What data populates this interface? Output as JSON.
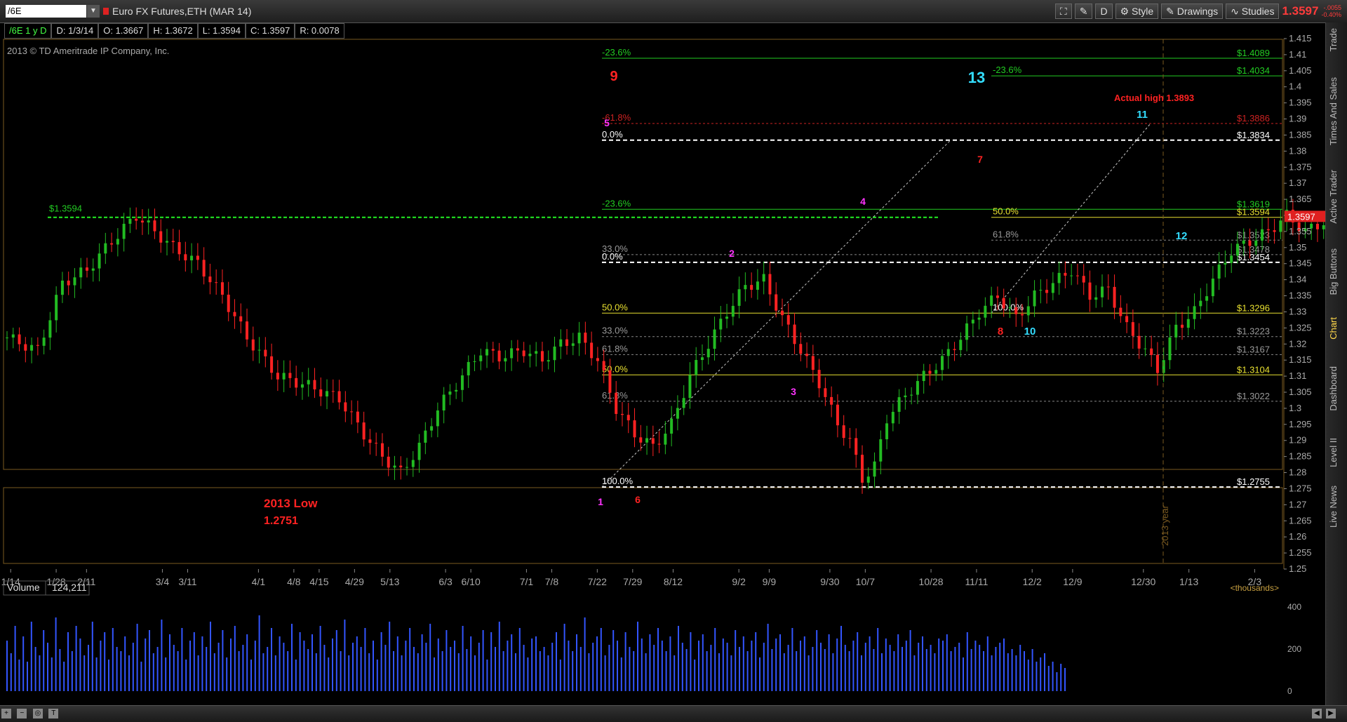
{
  "header": {
    "symbol": "/6E",
    "description": "Euro FX Futures,ETH (MAR 14)",
    "buttons": [
      "Style",
      "Drawings",
      "Studies"
    ],
    "last_price": "1.3597",
    "net_change": "-.0055",
    "pct_change": "-0.40%"
  },
  "infobar": {
    "period": "/6E 1 y D",
    "date": "D: 1/3/14",
    "open": "O: 1.3667",
    "high": "H: 1.3672",
    "low": "L: 1.3594",
    "close": "C: 1.3597",
    "range": "R: 0.0078"
  },
  "copyright": "2013 © TD Ameritrade IP Company, Inc.",
  "right_tabs": [
    "Trade",
    "Times And Sales",
    "Active Trader",
    "Big Buttons",
    "Chart",
    "Dashboard",
    "Level II",
    "Live News"
  ],
  "volume_panel": {
    "label": "Volume",
    "value": "124,211",
    "units": "<thousands>",
    "ticks": [
      "400",
      "200",
      "0"
    ]
  },
  "colors": {
    "up": "#22bb22",
    "down": "#ff2222",
    "volume": "#3355ff",
    "fib_green": "#22cc22",
    "fib_yellow": "#e8e030",
    "fib_red": "#cc2222",
    "wave_magenta": "#ff33ff",
    "wave_cyan": "#33ddff",
    "wave_red": "#ff2222"
  },
  "chart_data": {
    "type": "candlestick",
    "y_range": [
      1.25,
      1.415
    ],
    "y_ticks": [
      "1.415",
      "1.41",
      "1.405",
      "1.4",
      "1.395",
      "1.39",
      "1.385",
      "1.38",
      "1.375",
      "1.37",
      "1.365",
      "1.36",
      "1.355",
      "1.35",
      "1.345",
      "1.34",
      "1.335",
      "1.33",
      "1.325",
      "1.32",
      "1.315",
      "1.31",
      "1.305",
      "1.3",
      "1.295",
      "1.29",
      "1.285",
      "1.28",
      "1.275",
      "1.27",
      "1.265",
      "1.26",
      "1.255",
      "1.25"
    ],
    "x_ticks": [
      "1/14",
      "1/28",
      "2/11",
      "3/4",
      "3/11",
      "4/1",
      "4/8",
      "4/15",
      "4/29",
      "5/13",
      "6/3",
      "6/10",
      "7/1",
      "7/8",
      "7/22",
      "7/29",
      "8/12",
      "9/2",
      "9/9",
      "9/30",
      "10/7",
      "10/28",
      "11/11",
      "12/2",
      "12/9",
      "12/30",
      "1/13",
      "2/3"
    ],
    "last_price_marker": "1.3597",
    "year_marker": "2013 year",
    "close_path": [
      [
        0,
        1.322
      ],
      [
        5,
        1.318
      ],
      [
        9,
        1.339
      ],
      [
        13,
        1.343
      ],
      [
        17,
        1.352
      ],
      [
        21,
        1.36
      ],
      [
        24,
        1.355
      ],
      [
        27,
        1.35
      ],
      [
        31,
        1.345
      ],
      [
        35,
        1.335
      ],
      [
        39,
        1.322
      ],
      [
        44,
        1.31
      ],
      [
        49,
        1.307
      ],
      [
        54,
        1.303
      ],
      [
        58,
        1.292
      ],
      [
        61,
        1.285
      ],
      [
        64,
        1.28
      ],
      [
        67,
        1.288
      ],
      [
        70,
        1.3
      ],
      [
        74,
        1.31
      ],
      [
        77,
        1.318
      ],
      [
        80,
        1.316
      ],
      [
        84,
        1.318
      ],
      [
        87,
        1.315
      ],
      [
        90,
        1.32
      ],
      [
        93,
        1.322
      ],
      [
        96,
        1.315
      ],
      [
        99,
        1.3
      ],
      [
        102,
        1.292
      ],
      [
        105,
        1.288
      ],
      [
        108,
        1.295
      ],
      [
        111,
        1.31
      ],
      [
        114,
        1.32
      ],
      [
        117,
        1.33
      ],
      [
        120,
        1.338
      ],
      [
        123,
        1.34
      ],
      [
        126,
        1.328
      ],
      [
        129,
        1.318
      ],
      [
        132,
        1.308
      ],
      [
        135,
        1.295
      ],
      [
        137,
        1.29
      ],
      [
        139,
        1.278
      ],
      [
        141,
        1.282
      ],
      [
        143,
        1.297
      ],
      [
        146,
        1.304
      ],
      [
        149,
        1.31
      ],
      [
        152,
        1.315
      ],
      [
        155,
        1.322
      ],
      [
        158,
        1.33
      ],
      [
        161,
        1.335
      ],
      [
        164,
        1.328
      ],
      [
        167,
        1.335
      ],
      [
        170,
        1.339
      ],
      [
        173,
        1.343
      ],
      [
        176,
        1.335
      ],
      [
        179,
        1.337
      ],
      [
        182,
        1.325
      ],
      [
        185,
        1.318
      ],
      [
        187,
        1.312
      ],
      [
        190,
        1.325
      ],
      [
        193,
        1.33
      ],
      [
        196,
        1.34
      ],
      [
        199,
        1.349
      ],
      [
        202,
        1.352
      ],
      [
        205,
        1.355
      ],
      [
        208,
        1.36
      ],
      [
        211,
        1.355
      ],
      [
        214,
        1.358
      ],
      [
        217,
        1.353
      ],
      [
        220,
        1.36
      ],
      [
        223,
        1.372
      ],
      [
        226,
        1.38
      ],
      [
        229,
        1.383
      ],
      [
        232,
        1.376
      ],
      [
        234,
        1.368
      ],
      [
        236,
        1.355
      ],
      [
        238,
        1.345
      ],
      [
        240,
        1.348
      ],
      [
        242,
        1.34
      ],
      [
        244,
        1.333
      ],
      [
        246,
        1.34
      ],
      [
        249,
        1.344
      ],
      [
        252,
        1.348
      ],
      [
        255,
        1.354
      ],
      [
        258,
        1.36
      ],
      [
        261,
        1.365
      ],
      [
        264,
        1.372
      ],
      [
        267,
        1.378
      ],
      [
        270,
        1.376
      ],
      [
        272,
        1.378
      ],
      [
        274,
        1.368
      ],
      [
        276,
        1.37
      ],
      [
        278,
        1.375
      ],
      [
        280,
        1.389
      ],
      [
        282,
        1.378
      ],
      [
        284,
        1.368
      ],
      [
        286,
        1.36
      ]
    ],
    "volume_range": [
      0,
      450
    ],
    "volumes": [
      240,
      180,
      310,
      150,
      260,
      140,
      330,
      210,
      170,
      290,
      230,
      160,
      350,
      200,
      140,
      280,
      190,
      310,
      250,
      170,
      220,
      330,
      160,
      240,
      280,
      150,
      300,
      210,
      190,
      260,
      170,
      230,
      320,
      140,
      250,
      290,
      180,
      210,
      340,
      160,
      270,
      220,
      190,
      300,
      150,
      240,
      280,
      170,
      260,
      210,
      330,
      180,
      230,
      290,
      160,
      250,
      310,
      190,
      220,
      270,
      150,
      240,
      360,
      180,
      210,
      300,
      170,
      260,
      230,
      190,
      320,
      150,
      280,
      240,
      200,
      270,
      180,
      310,
      220,
      160,
      250,
      290,
      190,
      340,
      170,
      230,
      260,
      210,
      300,
      180,
      240,
      150,
      280,
      220,
      330,
      190,
      260,
      170,
      240,
      300,
      210,
      180,
      270,
      230,
      320,
      160,
      250,
      190,
      290,
      210,
      240,
      180,
      310,
      200,
      260,
      170,
      230,
      290,
      150,
      280,
      210,
      330,
      190,
      240,
      270,
      180,
      300,
      220,
      160,
      250,
      260,
      190,
      210,
      170,
      230,
      280,
      150,
      320,
      240,
      190,
      270,
      210,
      350,
      180,
      230,
      260,
      300,
      170,
      220,
      290,
      240,
      160,
      280,
      210,
      190,
      330,
      250,
      180,
      270,
      220,
      300,
      240,
      190,
      260,
      170,
      310,
      230,
      200,
      280,
      150,
      240,
      270,
      190,
      220,
      300,
      180,
      250,
      230,
      170,
      290,
      210,
      260,
      190,
      240,
      280,
      160,
      230,
      320,
      200,
      250,
      270,
      180,
      220,
      300,
      190,
      240,
      260,
      170,
      210,
      290,
      230,
      200,
      270,
      180,
      250,
      310,
      220,
      190,
      240,
      280,
      170,
      230,
      260,
      200,
      300,
      180,
      250,
      220,
      190,
      270,
      210,
      240,
      290,
      170,
      230,
      260,
      200,
      220,
      180,
      250,
      240,
      270,
      190,
      210,
      230,
      160,
      280,
      200,
      240,
      220,
      190,
      260,
      170,
      210,
      230,
      250,
      180,
      200,
      170,
      220,
      190,
      150,
      200,
      140,
      160,
      180,
      120,
      140,
      90,
      130,
      110
    ]
  },
  "annotations": {
    "hline_label": "$1.3594",
    "low_label": "2013 Low",
    "low_value": "1.2751",
    "actual_high": "Actual high 1.3893",
    "fib_left_pct": [
      "-23.6%",
      "-61.8%",
      "0.0%",
      "-23.6%",
      "33.0%",
      "0.0%",
      "50.0%",
      "33.0%",
      "61.8%",
      "50.0%",
      "61.8%",
      "100.0%"
    ],
    "fib_right_pct": [
      "-23.6%",
      "50.0%",
      "61.8%",
      "100.0%"
    ],
    "fib_prices": [
      "$1.4089",
      "$1.4034",
      "$1.3886",
      "$1.3834",
      "$1.3619",
      "$1.3594",
      "$1.3523",
      "$1.3478",
      "$1.3454",
      "$1.3296",
      "$1.3223",
      "$1.3167",
      "$1.3104",
      "$1.3022",
      "$1.2755"
    ],
    "wave_labels": [
      "1",
      "2",
      "3",
      "4",
      "5",
      "6",
      "7",
      "8",
      "9",
      "10",
      "11",
      "12",
      "13"
    ]
  }
}
